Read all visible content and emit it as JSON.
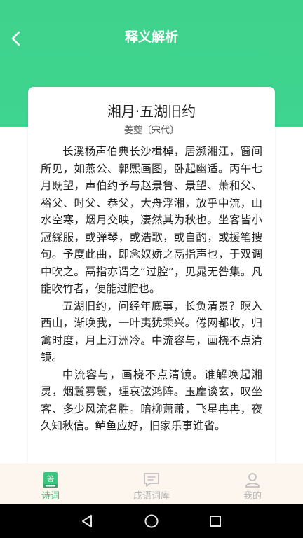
{
  "header": {
    "title": "释义解析",
    "back_icon": "chevron-left-icon"
  },
  "poem": {
    "title": "湘月·五湖旧约",
    "author": "姜夔〔宋代〕",
    "paragraphs": [
      "长溪杨声伯典长沙楫棹，居濒湘江，窗间所见，如燕公、郭熙画图，卧起幽适。丙午七月既望，声伯约予与赵景鲁、景望、萧和父、裕父、时父、恭父，大舟浮湘，放乎中流，山水空寒，烟月交映，凄然其为秋也。坐客皆小冠綵服，或弹琴，或浩歌，或自酌，或援笔搜句。予度此曲，即念奴娇之鬲指声也，于双调中吹之。鬲指亦谓之“过腔”，见晁无咎集。凡能吹竹者，便能过腔也。",
      "五湖旧约，问经年底事，长负清景？暝入西山，渐唤我，一叶夷犹乘兴。倦网都收，归禽时度，月上汀洲冷。中流容与，画桡不点清镜。",
      "中流容与，画桡不点清镜。谁解唤起湘灵，烟鬟雾鬟，理哀弦鸿阵。玉麈谈玄，叹坐客、多少风流名胜。暗柳萧萧，飞星冉冉，夜久知秋信。鲈鱼应好，旧家乐事谁省。"
    ]
  },
  "tabbar": {
    "tabs": [
      {
        "label": "诗词",
        "icon": "book-icon",
        "active": true
      },
      {
        "label": "成语词库",
        "icon": "chat-bubble-icon",
        "active": false
      },
      {
        "label": "我的",
        "icon": "user-icon",
        "active": false
      }
    ],
    "active_color": "#3cc57e",
    "inactive_color": "#b8b8b8"
  },
  "system_nav": {
    "buttons": [
      "back-triangle-icon",
      "home-circle-icon",
      "recents-square-icon"
    ]
  },
  "colors": {
    "header_green": "#3fd28c",
    "tabbar_bg": "#fdf6ee"
  }
}
